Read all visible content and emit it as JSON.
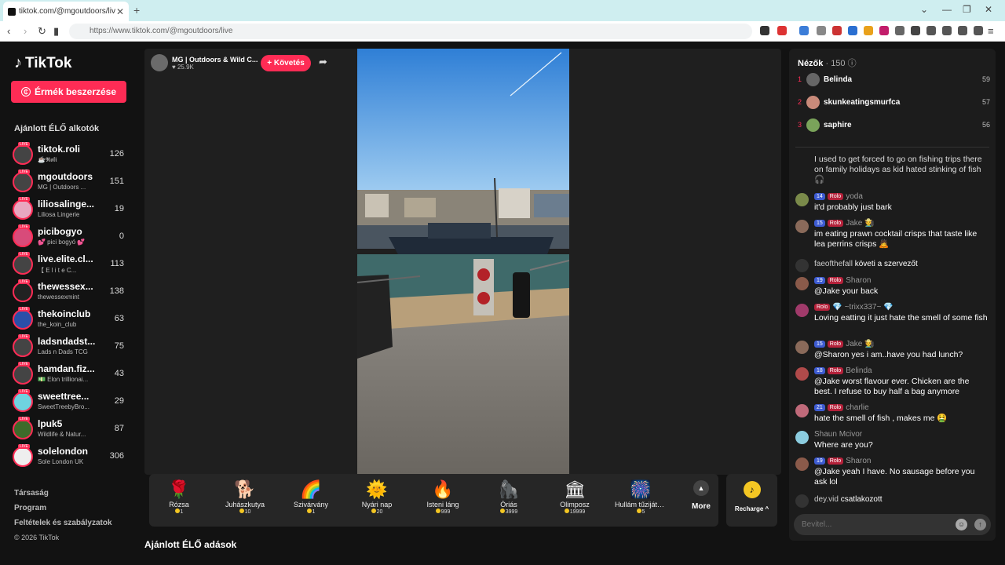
{
  "browser": {
    "tab_title": "tiktok.com/@mgoutdoors/liv",
    "url": "https://www.tiktok.com/@mgoutdoors/live"
  },
  "brand": {
    "name": "TikTok"
  },
  "sidebar": {
    "coins_button": "Érmék beszerzése",
    "heading": "Ajánlott ÉLŐ alkotók",
    "creators": [
      {
        "name": "tiktok.roli",
        "sub": "☕𝕽𝖔𝖑𝖎",
        "count": "126"
      },
      {
        "name": "mgoutdoors",
        "sub": "MG | Outdoors ...",
        "count": "151"
      },
      {
        "name": "liliosalinge...",
        "sub": "Liliosa Lingerie",
        "count": "19"
      },
      {
        "name": "picibogyo",
        "sub": "💕 pici bogyó 💕",
        "count": "0"
      },
      {
        "name": "live.elite.cl...",
        "sub": "【 E l i t e C...",
        "count": "113"
      },
      {
        "name": "thewessex...",
        "sub": "thewessexmint",
        "count": "138"
      },
      {
        "name": "thekoinclub",
        "sub": "the_koin_club",
        "count": "63"
      },
      {
        "name": "ladsndadst...",
        "sub": "Lads n Dads TCG",
        "count": "75"
      },
      {
        "name": "hamdan.fiz...",
        "sub": "💵 Elon trillionai...",
        "count": "43"
      },
      {
        "name": "sweettree...",
        "sub": "SweetTreebyBro...",
        "count": "29"
      },
      {
        "name": "lpuk5",
        "sub": "Wildlife & Natur...",
        "count": "87"
      },
      {
        "name": "solelondon",
        "sub": "Sole London UK",
        "count": "306"
      }
    ],
    "live_badge": "LIVE",
    "links": [
      "Társaság",
      "Program",
      "Feltételek és szabályzatok"
    ],
    "copyright": "© 2026 TikTok"
  },
  "stream": {
    "host_name": "MG | Outdoors & Wild C...",
    "likes": "25.9K",
    "follow_label": "+ Követés"
  },
  "gifts": [
    {
      "name": "Rózsa",
      "price": "1",
      "icon": "🌹"
    },
    {
      "name": "Juhászkutya",
      "price": "10",
      "icon": "🐕"
    },
    {
      "name": "Szivárvány",
      "price": "1",
      "icon": "🌈"
    },
    {
      "name": "Nyári nap",
      "price": "20",
      "icon": "🌞"
    },
    {
      "name": "Isteni láng",
      "price": "999",
      "icon": "🔥"
    },
    {
      "name": "Óriás",
      "price": "3999",
      "icon": "🦍"
    },
    {
      "name": "Olimposz",
      "price": "19999",
      "icon": "🏛"
    },
    {
      "name": "Hullám tűzijátk...",
      "price": "5",
      "icon": "🎆"
    }
  ],
  "more_label": "More",
  "recharge_label": "Recharge ^",
  "recommended_heading": "Ajánlott ÉLŐ adások",
  "chat": {
    "viewers_label": "Nézők",
    "viewers_count": "· 150",
    "top_viewers": [
      {
        "rank": "1",
        "name": "Belinda",
        "score": "59"
      },
      {
        "rank": "2",
        "name": "skunkeatingsmurfca",
        "score": "57"
      },
      {
        "rank": "3",
        "name": "saphire",
        "score": "56"
      }
    ],
    "messages": [
      {
        "user": "",
        "text": "I used to get forced to go on fishing trips there on family holidays as kid hated stinking of fish 🎧",
        "lvl": "",
        "fan": ""
      },
      {
        "user": "yoda",
        "text": "it'd probably just bark",
        "lvl": "14",
        "fan": "Rolo"
      },
      {
        "user": "Jake 🧑‍🌾",
        "text": "im eating prawn cocktail crisps that taste like lea perrins crisps 🙇",
        "lvl": "15",
        "fan": "Rolo"
      },
      {
        "user": "faeofthefall",
        "text": "követi a szervezőt",
        "lvl": "",
        "fan": ""
      },
      {
        "user": "Sharon",
        "text": "@Jake your back",
        "lvl": "19",
        "fan": "Rolo"
      },
      {
        "user": "💎 ~trixx337~ 💎",
        "text": "Loving eatting it just hate the smell of some fish",
        "lvl": "",
        "fan": "Rolo"
      },
      {
        "user": "Jake 🧑‍🌾",
        "text": "@Sharon yes i am..have you had lunch?",
        "lvl": "15",
        "fan": "Rolo"
      },
      {
        "user": "Belinda",
        "text": "@Jake worst flavour ever. Chicken are the best. I refuse to buy half a bag anymore",
        "lvl": "18",
        "fan": "Rolo"
      },
      {
        "user": "charlie",
        "text": "hate the smell of fish , makes me 🤮",
        "lvl": "21",
        "fan": "Rolo"
      },
      {
        "user": "Shaun Mcivor",
        "text": "Where are you?",
        "lvl": "",
        "fan": ""
      },
      {
        "user": "Sharon",
        "text": "@Jake yeah I have. No sausage before you ask lol",
        "lvl": "19",
        "fan": "Rolo"
      },
      {
        "user": "dey.vid",
        "text": "csatlakozott",
        "lvl": "",
        "fan": ""
      }
    ],
    "input_placeholder": "Bevitel..."
  }
}
